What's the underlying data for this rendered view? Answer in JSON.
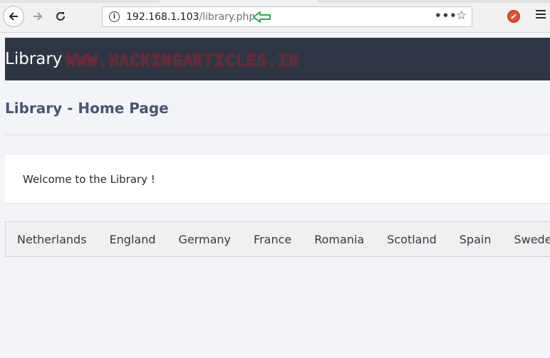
{
  "browser": {
    "url_host": "192.168.1.103",
    "url_path": "/library.php",
    "icons": {
      "back": "back-arrow-icon",
      "forward": "forward-arrow-icon",
      "reload": "reload-icon",
      "info": "info-icon",
      "annotation": "green-left-arrow-icon",
      "page_actions": "more-dots-icon",
      "bookmark": "star-icon",
      "extension": "extension-icon",
      "menu": "hamburger-menu-icon"
    }
  },
  "header": {
    "brand": "Library",
    "watermark": "WWW.HACKINGARTICLES.IN"
  },
  "main": {
    "title": "Library - Home Page",
    "welcome": "Welcome to the Library !",
    "countries": [
      "Netherlands",
      "England",
      "Germany",
      "France",
      "Romania",
      "Scotland",
      "Spain",
      "Sweden"
    ]
  },
  "colors": {
    "header_bg": "#2e3646",
    "title_color": "#495571",
    "annotation_arrow": "#2fa84f",
    "page_bg": "#f3f4f8"
  }
}
